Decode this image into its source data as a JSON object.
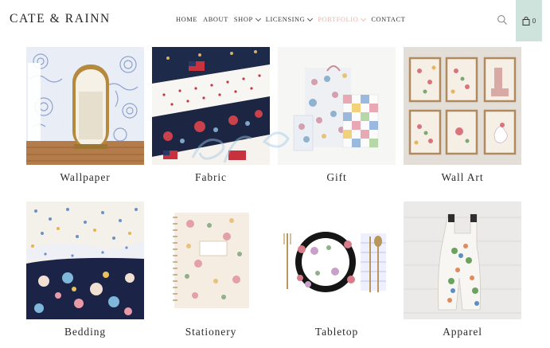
{
  "brand": {
    "logo_text": "CATE & RAINN"
  },
  "nav": [
    {
      "label": "HOME"
    },
    {
      "label": "ABOUT"
    },
    {
      "label": "SHOP"
    },
    {
      "label": "LICENSING"
    },
    {
      "label": "PORTFOLIO"
    },
    {
      "label": "CONTACT"
    }
  ],
  "cart": {
    "count": "0"
  },
  "icons": {
    "search": "search-icon",
    "cart": "bag-icon",
    "dropdown": "chevron-down-icon"
  },
  "colors": {
    "accent": "#e8b4ae",
    "cart_bg": "#cfe3dd",
    "text": "#2b2b2b"
  },
  "categories": [
    {
      "label": "Wallpaper"
    },
    {
      "label": "Fabric"
    },
    {
      "label": "Gift"
    },
    {
      "label": "Wall Art"
    },
    {
      "label": "Bedding"
    },
    {
      "label": "Stationery"
    },
    {
      "label": "Tabletop"
    },
    {
      "label": "Apparel"
    }
  ]
}
